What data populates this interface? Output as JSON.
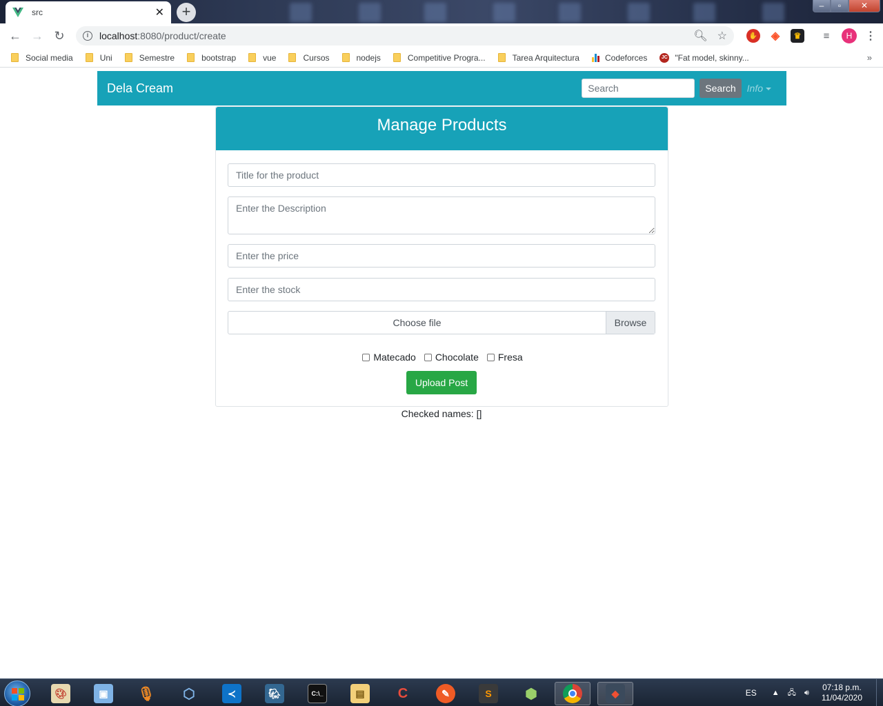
{
  "browser": {
    "tab": {
      "title": "src",
      "close": "✕"
    },
    "new_tab": "+",
    "window": {
      "minimize": "–",
      "maximize": "▫",
      "close": "✕"
    },
    "nav": {
      "back": "←",
      "forward": "→",
      "reload": "↻"
    },
    "url": {
      "host": "localhost",
      "path": ":8080/product/create"
    },
    "bookmarks": [
      {
        "label": "Social media",
        "icon": "folder-icon"
      },
      {
        "label": "Uni",
        "icon": "folder-icon"
      },
      {
        "label": "Semestre",
        "icon": "folder-icon"
      },
      {
        "label": "bootstrap",
        "icon": "folder-icon"
      },
      {
        "label": "vue",
        "icon": "folder-icon"
      },
      {
        "label": "Cursos",
        "icon": "folder-icon"
      },
      {
        "label": "nodejs",
        "icon": "folder-icon"
      },
      {
        "label": "Competitive Progra...",
        "icon": "folder-icon"
      },
      {
        "label": "Tarea Arquitectura",
        "icon": "folder-icon"
      },
      {
        "label": "Codeforces",
        "icon": "codeforces-icon"
      },
      {
        "label": "\"Fat model, skinny...",
        "icon": "jc-icon"
      }
    ],
    "bookmarks_more": "»",
    "avatar_letter": "H"
  },
  "navbar": {
    "brand": "Dela Cream",
    "search_placeholder": "Search",
    "search_button": "Search",
    "info_label": "Info"
  },
  "form": {
    "header": "Manage Products",
    "title_placeholder": "Title for the product",
    "description_placeholder": "Enter the Description",
    "price_placeholder": "Enter the price",
    "stock_placeholder": "Enter the stock",
    "file_label": "Choose file",
    "file_browse": "Browse",
    "flavors": [
      "Matecado",
      "Chocolate",
      "Fresa"
    ],
    "submit": "Upload Post",
    "checked_names_label": "Checked names: ",
    "checked_names_value": "[]"
  },
  "taskbar": {
    "language": "ES",
    "time": "07:18 p.m.",
    "date": "11/04/2020"
  },
  "colors": {
    "primary": "#17a2b8",
    "success": "#28a745",
    "secondary": "#6c757d"
  }
}
